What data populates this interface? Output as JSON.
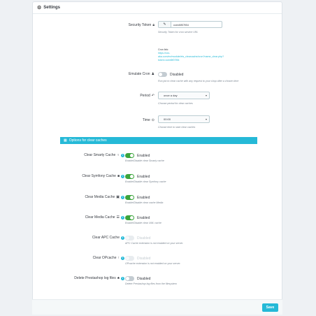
{
  "panel": {
    "title": "Settings"
  },
  "security": {
    "label": "Security Token",
    "value": "cced6f07f84",
    "help": "Security Token for cron service URL"
  },
  "cron_link": {
    "title": "Cron link:",
    "line1": "https://xxx-",
    "line2": "aka.com/en/module/ets_clearcache/cron?name_clear.php?",
    "line3": "token=cced6f07f84"
  },
  "emulate": {
    "label": "Emulate Cron",
    "state": "Disabled",
    "help": "Run job to clear cache with any request to your shop after a chosen time"
  },
  "period": {
    "label": "Period",
    "value": "once a day",
    "help": "Choose period for clear caches"
  },
  "time": {
    "label": "Time",
    "value": "00:00",
    "help": "Choose time to start clear caches"
  },
  "section": {
    "title": "Options for clear caches"
  },
  "options": [
    {
      "label": "Clear Smarty Cache",
      "state": "Enabled",
      "help": "Enable/Disable clear Smarty cache"
    },
    {
      "label": "Clear Symfony Cache",
      "state": "Enabled",
      "help": "Enable/Disable clear Symfony cache"
    },
    {
      "label": "Clear Media Cache",
      "state": "Enabled",
      "help": "Enable/Disable clear cache Media"
    },
    {
      "label": "Clear Media Cache",
      "state": "Enabled",
      "help": "Enable/Disable clear XML cache"
    },
    {
      "label": "Clear APC Cache",
      "state": "Disabled",
      "help": "APC Cache extension is not enabled on your server."
    },
    {
      "label": "Clear OPcache",
      "state": "Disabled",
      "help": "OPcache extension is not enabled on your server."
    },
    {
      "label": "Delete Prestashop log files",
      "state": "Disabled",
      "help": "Delete Prestashop log files from the filesystem"
    }
  ],
  "footer": {
    "save": "Save"
  },
  "colors": {
    "accent": "#25b9d7",
    "enabled": "#3ca53c"
  }
}
